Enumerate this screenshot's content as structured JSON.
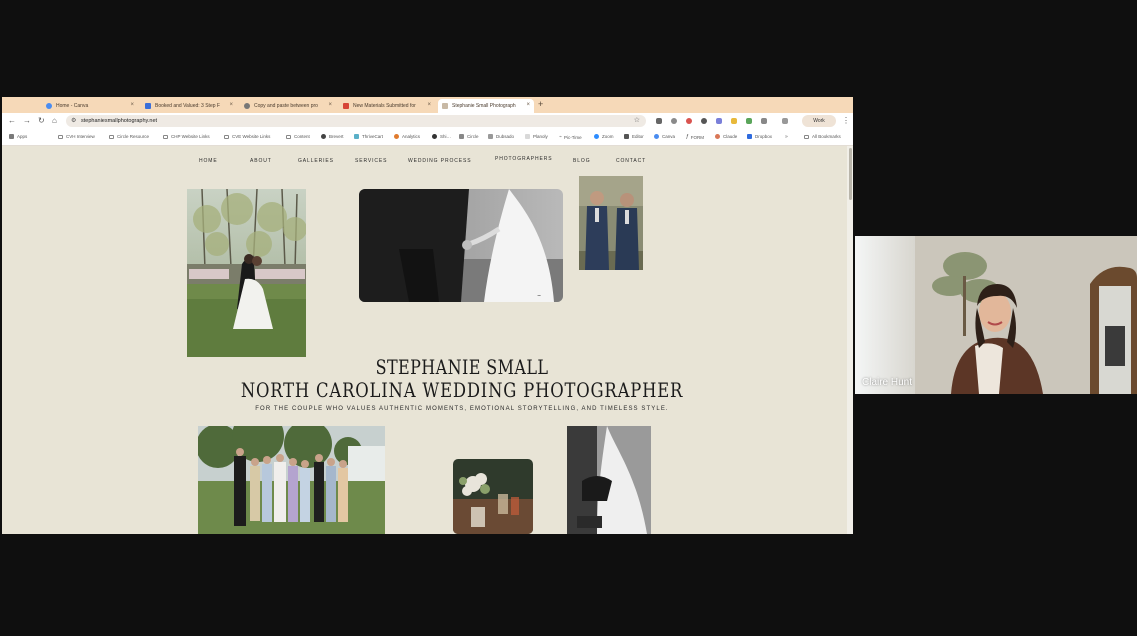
{
  "browser": {
    "tabs": [
      {
        "title": "Home - Canva",
        "color": "#4a8cf0"
      },
      {
        "title": "Booked and Valued: 3 Step F",
        "color": "#3b6fd9"
      },
      {
        "title": "Copy and paste between pro",
        "color": "#777777"
      },
      {
        "title": "New Materials Submitted for",
        "color": "#d64537"
      },
      {
        "title": "Stephanie Small Photograph",
        "color": "#c8b9a5"
      }
    ],
    "url": "stephaniesmallphotography.net",
    "profile_label": "Work",
    "bookmarks": [
      "Apps",
      "CVH Interview",
      "Circle Resource",
      "CHP Website Links",
      "CVE Website Links",
      "Content",
      "Brevert",
      "ThriveCart",
      "Analytics",
      "Shi…",
      "Circle",
      "Dubsado",
      "Planoly",
      "Pic-Time",
      "Zoom",
      "Editor",
      "Canva",
      "FORM",
      "Claude",
      "Dropbox"
    ],
    "all_bookmarks_label": "All Bookmarks"
  },
  "site": {
    "nav": [
      "HOME",
      "ABOUT",
      "GALLERIES",
      "SERVICES",
      "WEDDING PROCESS",
      "PHOTOGRAPHERS",
      "BLOG",
      "CONTACT"
    ],
    "hero_name": "STEPHANIE SMALL",
    "hero_subtitle": "NORTH CAROLINA WEDDING PHOTOGRAPHER",
    "tagline": "FOR THE COUPLE WHO VALUES AUTHENTIC MOMENTS, EMOTIONAL STORYTELLING, AND TIMELESS STYLE."
  },
  "participant": {
    "name": "Claire Hunt"
  }
}
